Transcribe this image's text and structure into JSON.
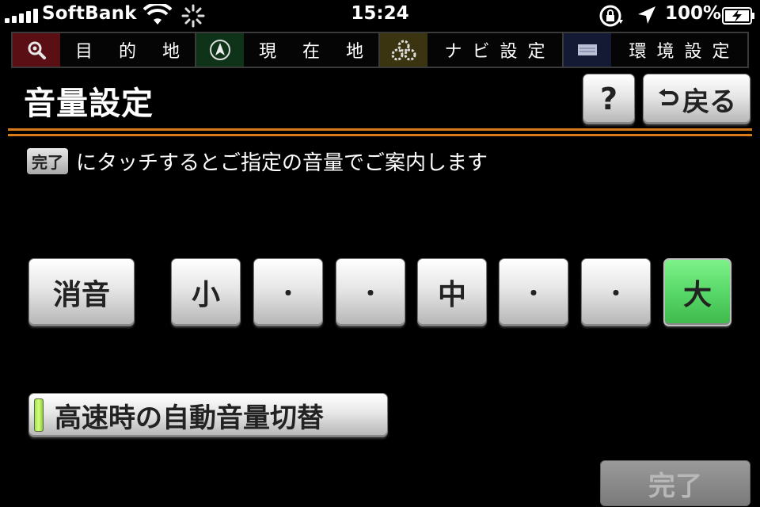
{
  "status_bar": {
    "carrier": "SoftBank",
    "time": "15:24",
    "battery_percent": "100%"
  },
  "nav_tabs": [
    {
      "label": "目 的 地",
      "icon": "search-magnifier-icon",
      "accent": "#5a0f14"
    },
    {
      "label": "現 在 地",
      "icon": "compass-arrow-icon",
      "accent": "#0f3318"
    },
    {
      "label": "ナビ設定",
      "icon": "gear-cluster-icon",
      "accent": "#3a3410"
    },
    {
      "label": "環境設定",
      "icon": "display-panel-icon",
      "accent": "#141a33"
    }
  ],
  "header": {
    "title": "音量設定",
    "help_label": "?",
    "back_label": "戻る"
  },
  "instruction": {
    "chip_label": "完了",
    "text": "にタッチするとご指定の音量でご案内します"
  },
  "volume": {
    "mute_label": "消音",
    "levels": [
      "小",
      "・",
      "・",
      "中",
      "・",
      "・",
      "大"
    ],
    "selected_level": "大",
    "selected_color": "#5fdc6c"
  },
  "highway_toggle": {
    "label": "高速時の自動音量切替",
    "indicator_color": "#b6f26a"
  },
  "done_button": {
    "label": "完了",
    "enabled": false
  },
  "colors": {
    "accent_rule": "#d97a1c",
    "background": "#000000"
  }
}
